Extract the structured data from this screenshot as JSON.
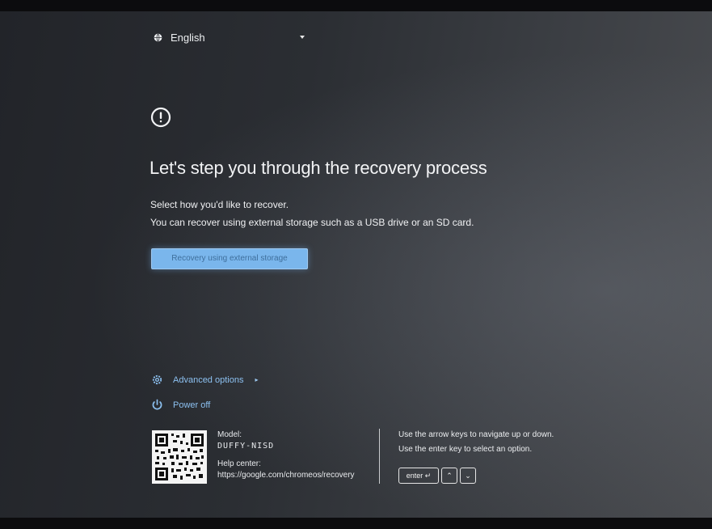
{
  "language": {
    "label": "English",
    "icon": "globe-icon"
  },
  "header": {
    "alert_icon": "alert-circle-icon"
  },
  "main": {
    "title": "Let's step you through the recovery process",
    "subtitle_line1": "Select how you'd like to recover.",
    "subtitle_line2": "You can recover using external storage such as a USB drive or an SD card.",
    "recover_button": "Recovery using external storage"
  },
  "options": {
    "advanced_label": "Advanced options",
    "advanced_chevron": "▸",
    "power_label": "Power off"
  },
  "device": {
    "model_label": "Model:",
    "model_value": "DUFFY-NISD",
    "help_center_label": "Help center:",
    "help_center_url": "https://google.com/chromeos/recovery"
  },
  "help": {
    "line1": "Use the arrow keys to navigate up or down.",
    "line2": "Use the enter key to select an option."
  },
  "keys": {
    "enter": "enter ↵",
    "up": "⌃",
    "down": "⌄"
  },
  "colors": {
    "accent": "#7ab6ec",
    "link": "#8cc0f0",
    "background": "#2b2e33",
    "text": "#f0f1f3"
  }
}
